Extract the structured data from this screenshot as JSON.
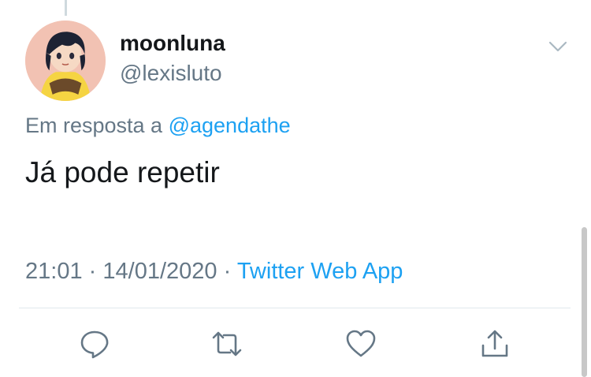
{
  "tweet": {
    "display_name": "moonluna",
    "handle": "@lexisluto",
    "reply_prefix": "Em resposta a",
    "reply_mention": "@agendathe",
    "text": "Já pode repetir",
    "time": "21:01",
    "separator": "·",
    "date": "14/01/2020",
    "source": "Twitter Web App"
  },
  "actions": [
    {
      "name": "reply",
      "icon": "speech-bubble-icon"
    },
    {
      "name": "retweet",
      "icon": "retweet-icon"
    },
    {
      "name": "like",
      "icon": "heart-icon"
    },
    {
      "name": "share",
      "icon": "share-icon"
    }
  ],
  "colors": {
    "text": "#14171a",
    "secondary": "#657786",
    "accent": "#1da1f2",
    "divider": "#e1e8ed"
  }
}
